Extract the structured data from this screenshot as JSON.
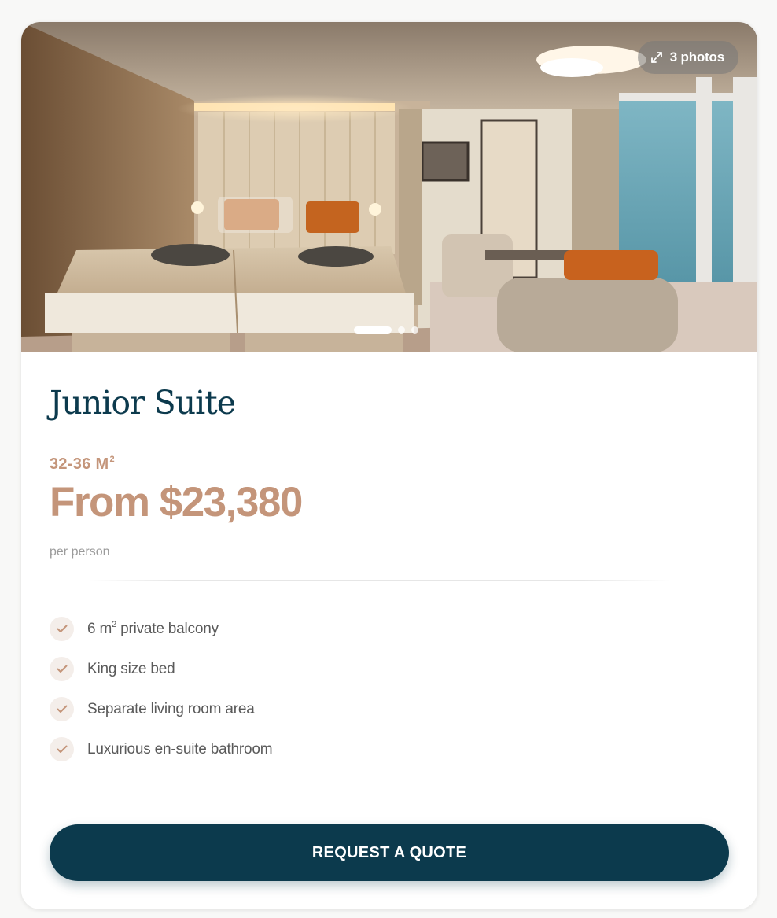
{
  "card": {
    "photo_count_label": "3 photos",
    "carousel": {
      "total": 3,
      "active": 1
    },
    "title": "Junior Suite",
    "size_label": "32-36 M",
    "size_sup": "2",
    "price_label": "From $23,380",
    "price_note": "per person",
    "features": [
      {
        "text": "6 m",
        "sup": "2",
        "rest": " private balcony"
      },
      {
        "text": "King size bed"
      },
      {
        "text": "Separate living room area"
      },
      {
        "text": "Luxurious en-suite bathroom"
      }
    ],
    "cta_label": "REQUEST A QUOTE"
  },
  "colors": {
    "brand_dark": "#0c3a4d",
    "accent_tan": "#c4957a",
    "check_bg": "#f4eeea"
  },
  "icons": {
    "expand": "expand-arrows-icon",
    "check": "checkmark-icon"
  }
}
